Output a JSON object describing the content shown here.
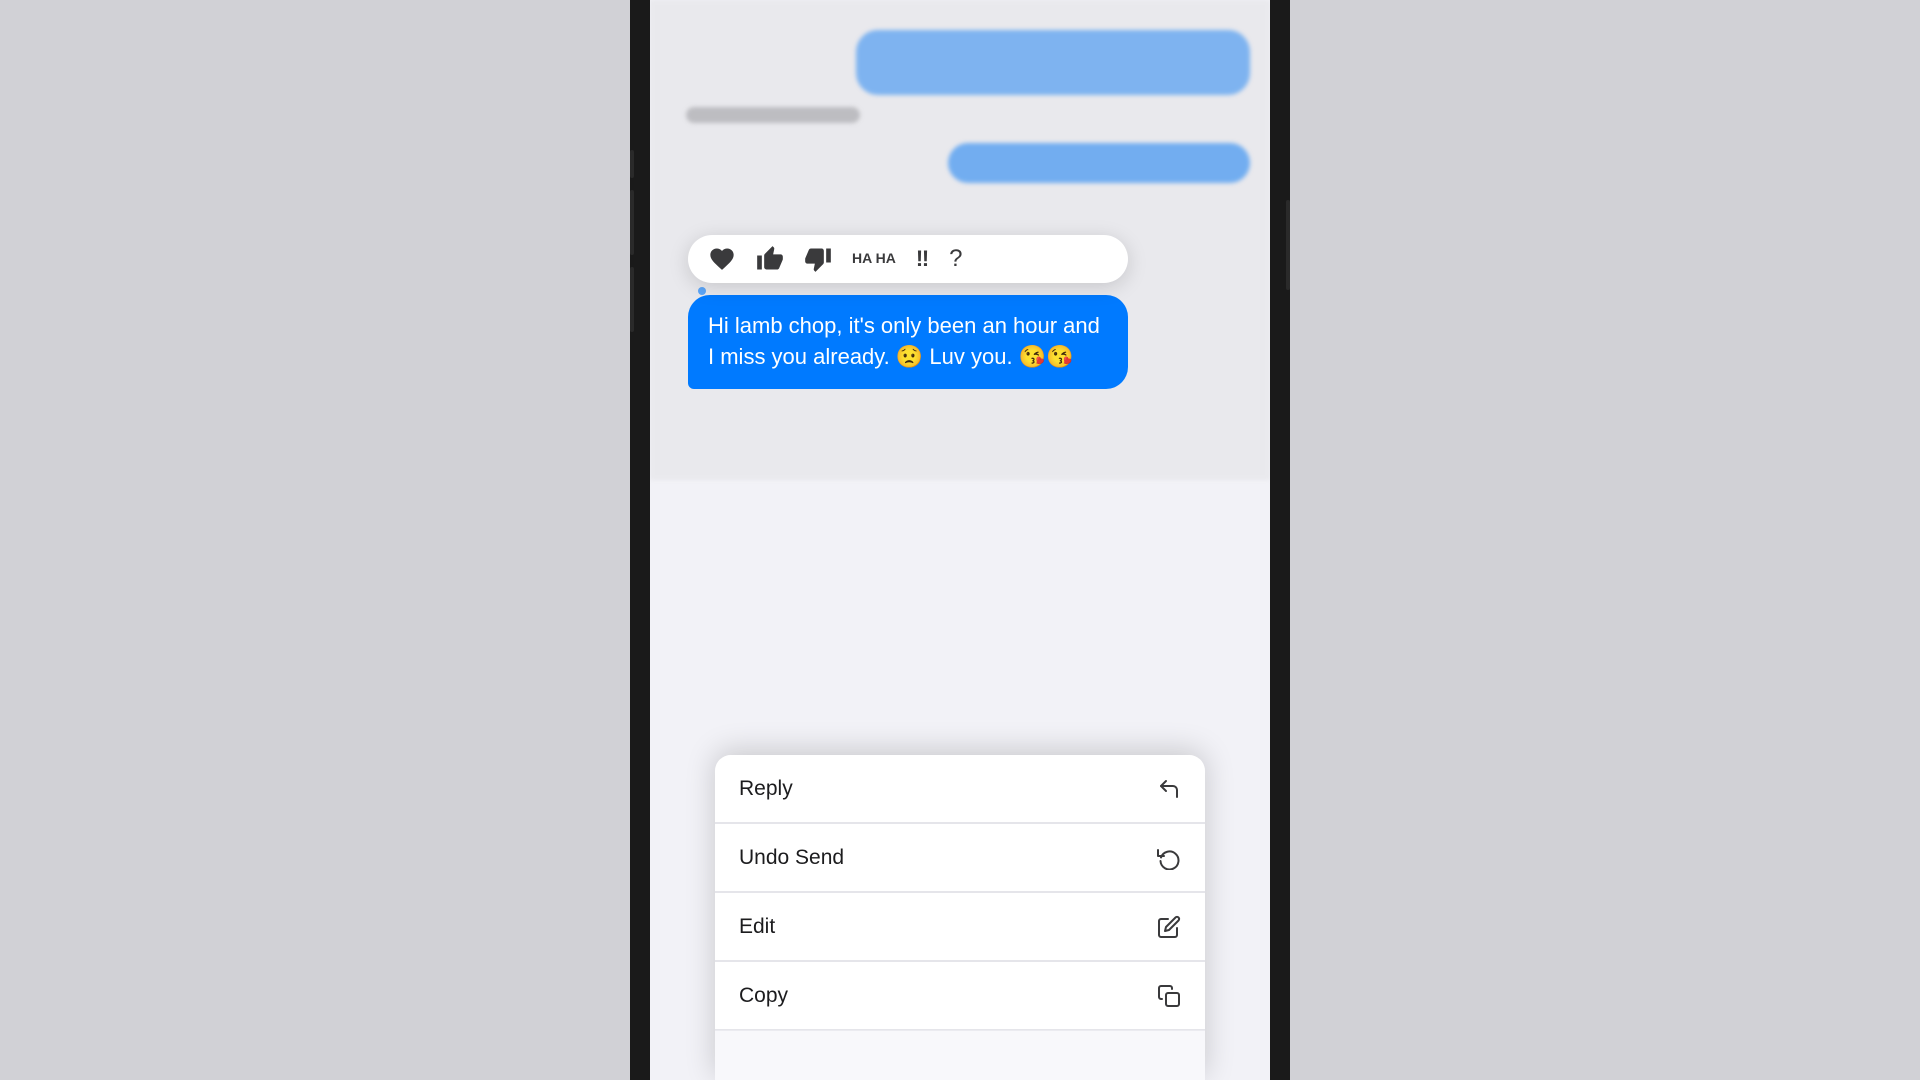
{
  "scene": {
    "bg_color": "#c8c8cc"
  },
  "phone": {
    "screen_bg": "#f2f2f7"
  },
  "reactions": {
    "heart": "♥",
    "thumbs_up": "👍",
    "thumbs_down": "👎",
    "haha": "HA\nHA",
    "exclaim": "‼",
    "question": "?"
  },
  "message": {
    "text": "Hi lamb chop, it's only been an hour and I miss you already. 😟 Luv you. 😘😘"
  },
  "context_menu": {
    "items": [
      {
        "label": "Reply",
        "icon": "reply"
      },
      {
        "label": "Undo Send",
        "icon": "undo"
      },
      {
        "label": "Edit",
        "icon": "pencil"
      },
      {
        "label": "Copy",
        "icon": "copy"
      }
    ]
  }
}
